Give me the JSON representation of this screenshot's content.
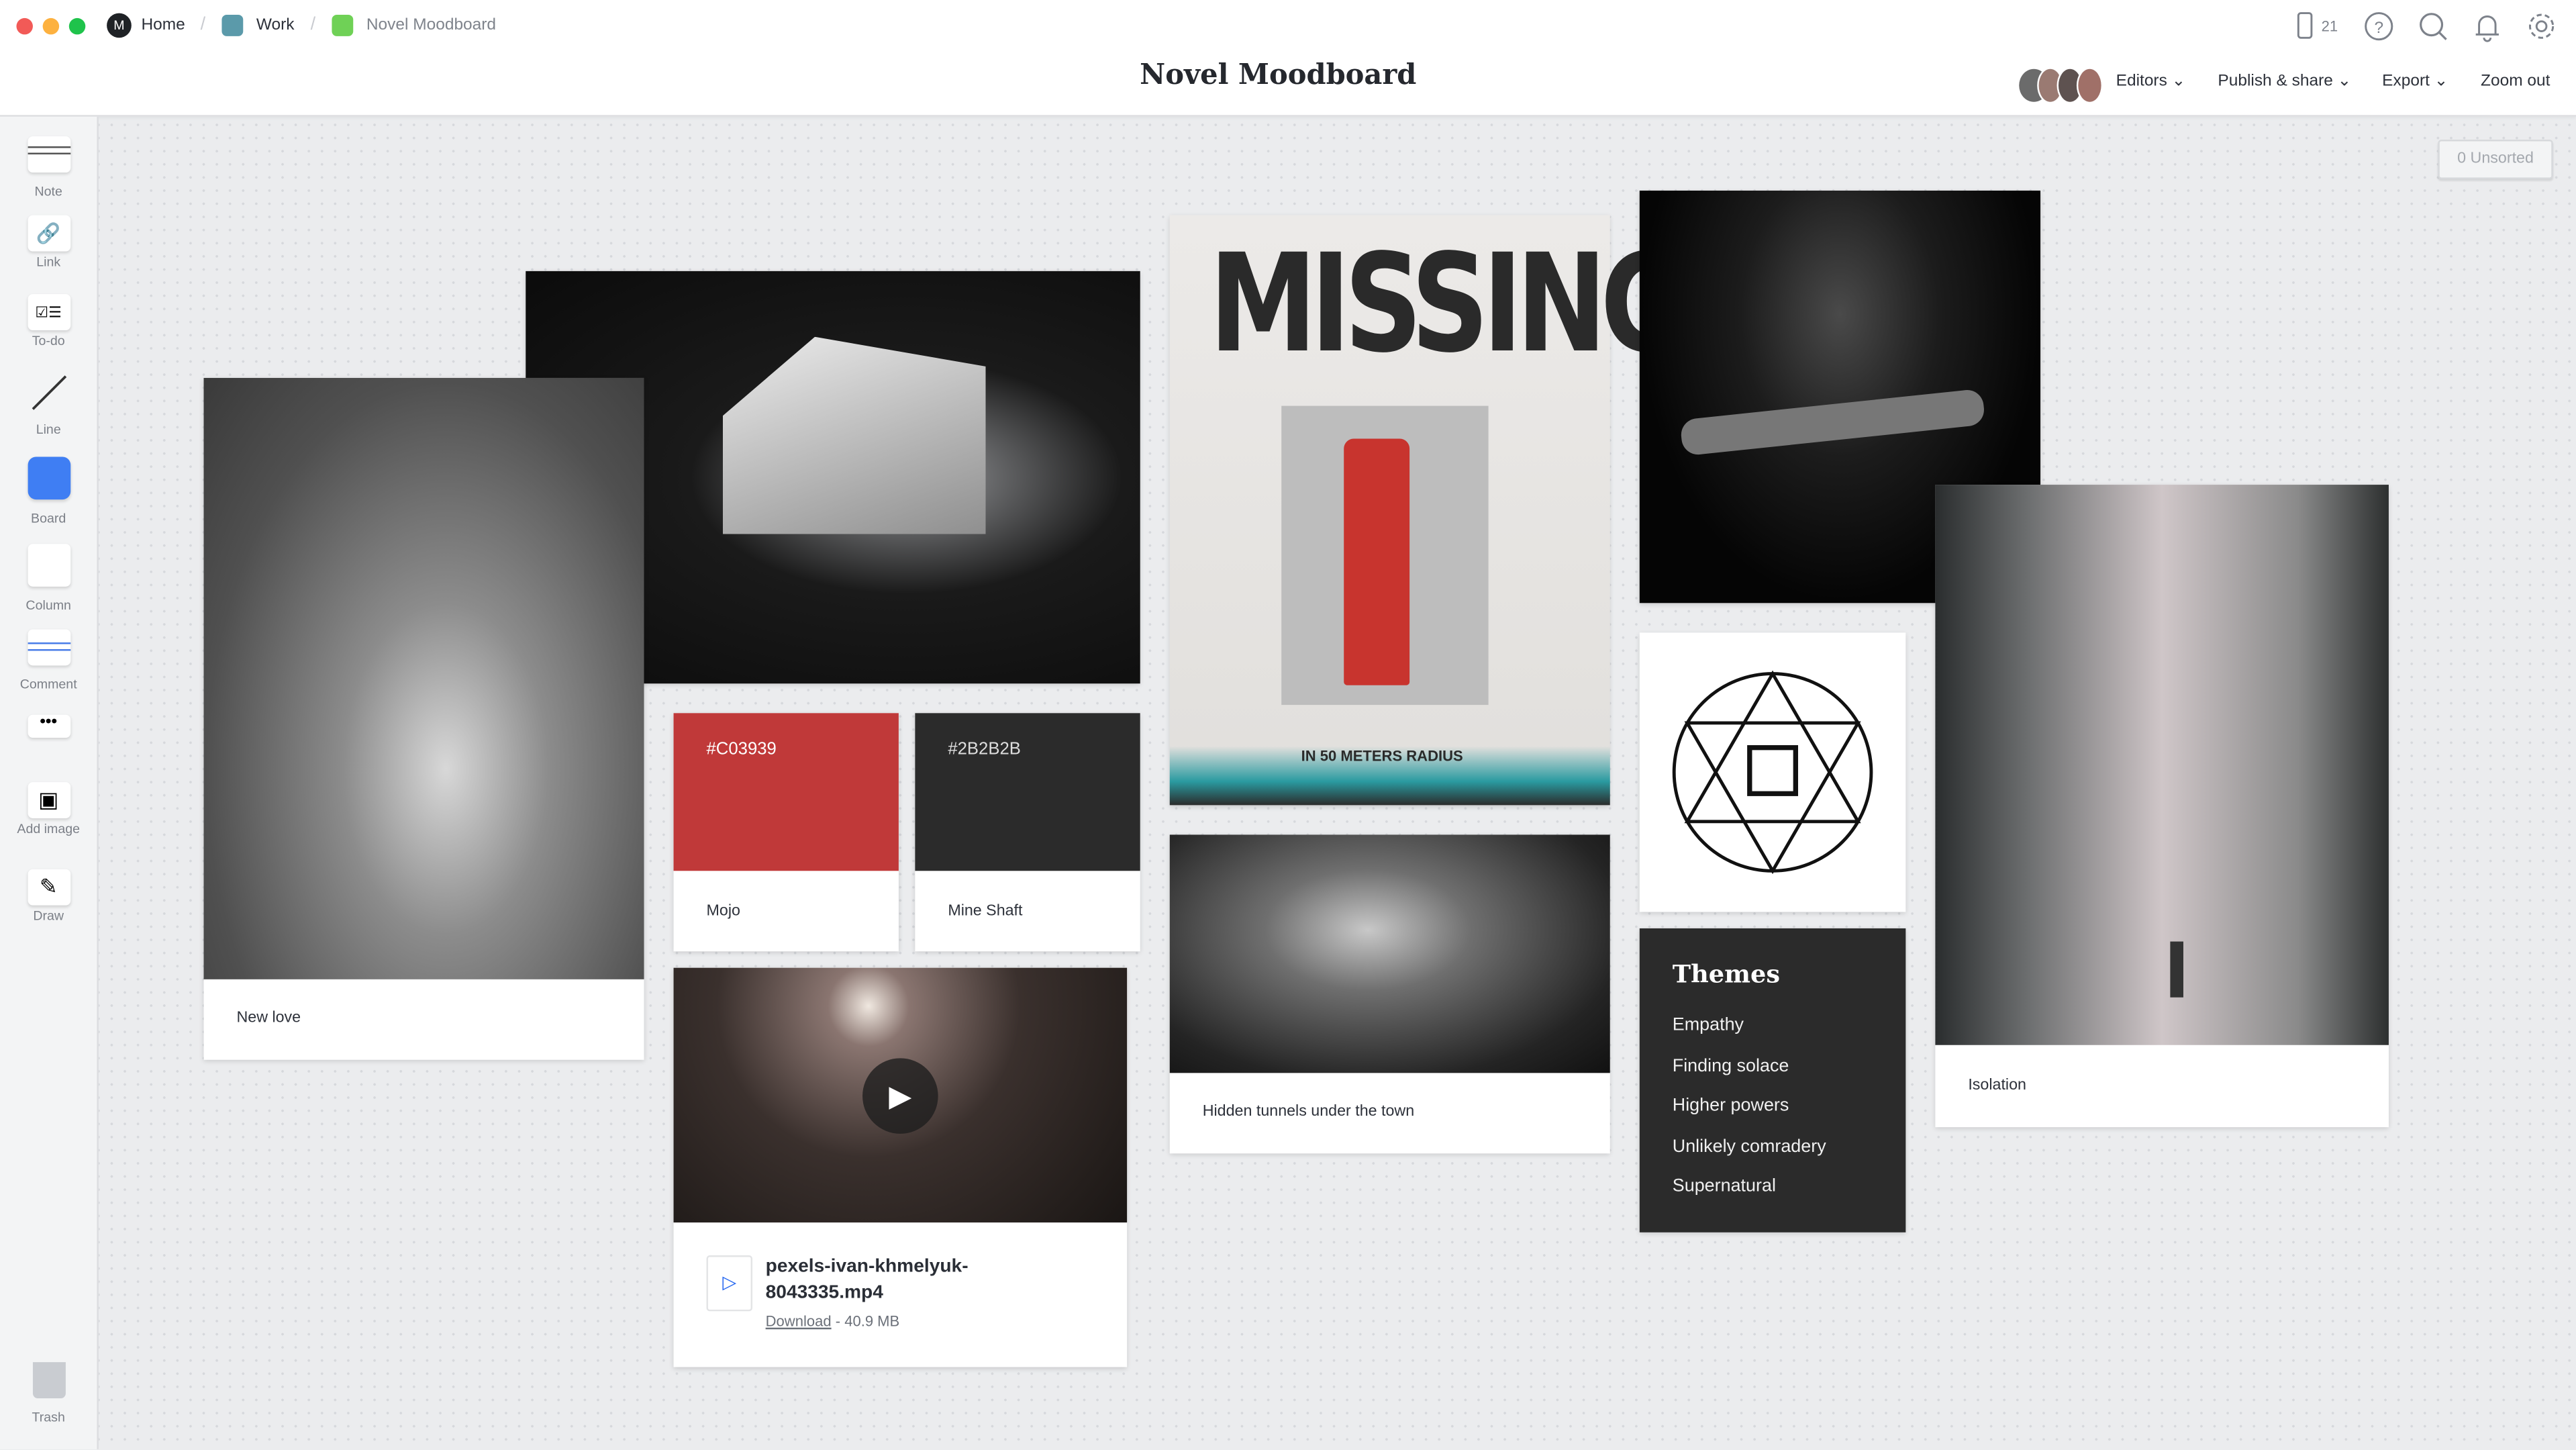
{
  "breadcrumb": {
    "home": "Home",
    "work": "Work",
    "current": "Novel Moodboard",
    "work_color": "#5B9AAA",
    "current_color": "#6FD156"
  },
  "header": {
    "title": "Novel Moodboard",
    "device_count": "21",
    "editors": "Editors",
    "publish": "Publish & share",
    "export": "Export",
    "zoom_out": "Zoom out"
  },
  "sidebar": {
    "items": [
      {
        "label": "Note",
        "icon": "note-icon"
      },
      {
        "label": "Link",
        "icon": "link-icon"
      },
      {
        "label": "To-do",
        "icon": "todo-icon"
      },
      {
        "label": "Line",
        "icon": "line-icon"
      },
      {
        "label": "Board",
        "icon": "board-icon"
      },
      {
        "label": "Column",
        "icon": "column-icon"
      },
      {
        "label": "Comment",
        "icon": "comment-icon"
      },
      {
        "label": "Add image",
        "icon": "image-icon"
      },
      {
        "label": "Draw",
        "icon": "pencil-icon"
      },
      {
        "label": "Trash",
        "icon": "trash-icon"
      }
    ]
  },
  "unsorted": "0 Unsorted",
  "cards": {
    "hands": {
      "caption": "New love"
    },
    "mojo": {
      "hex": "#C03939",
      "name": "Mojo"
    },
    "mineshaft": {
      "hex": "#2B2B2B",
      "name": "Mine Shaft"
    },
    "video": {
      "filename": "pexels-ivan-khmelyuk-8043335.mp4",
      "download": "Download",
      "size": " - 40.9 MB"
    },
    "poster": {
      "headline": "MISSING",
      "footer": "IN 50 METERS RADIUS"
    },
    "forest": {
      "caption": "Hidden tunnels under the town"
    },
    "isolation": {
      "caption": "Isolation"
    },
    "themes": {
      "title": "Themes",
      "items": [
        "Empathy",
        "Finding solace",
        "Higher powers",
        "Unlikely comradery",
        "Supernatural"
      ]
    }
  }
}
